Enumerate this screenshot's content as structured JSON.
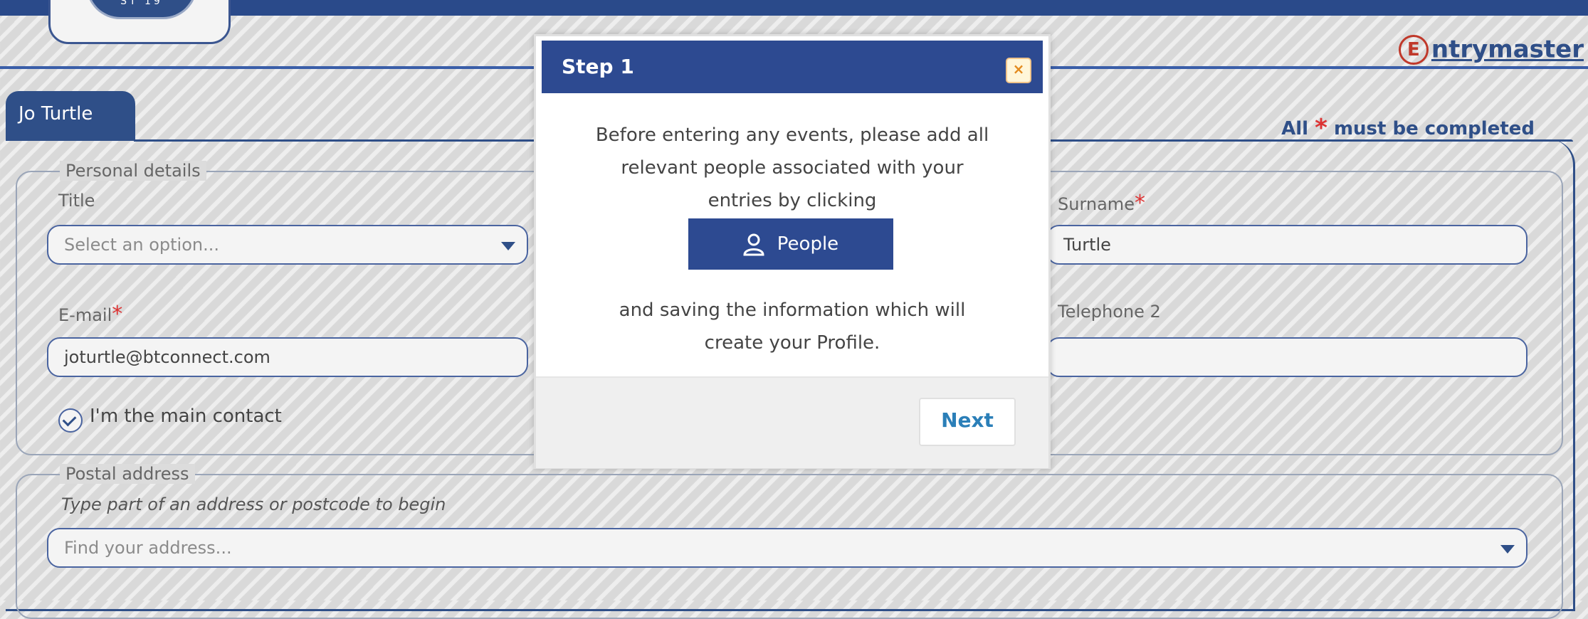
{
  "header": {
    "seal_text": "ST 19",
    "brand_initial": "E",
    "brand_rest": "ntrymaster"
  },
  "tab": {
    "label": "Jo Turtle"
  },
  "required_note": {
    "prefix": "All",
    "star": "*",
    "suffix": "must be completed"
  },
  "personal": {
    "legend": "Personal details",
    "title_label": "Title",
    "title_placeholder": "Select an option...",
    "surname_label": "Surname",
    "surname_star": "*",
    "surname_value": "Turtle",
    "email_label": "E-mail",
    "email_star": "*",
    "email_value": "joturtle@btconnect.com",
    "telephone2_label": "Telephone 2",
    "telephone2_value": "",
    "main_contact_label": "I'm the main contact"
  },
  "postal": {
    "legend": "Postal address",
    "hint": "Type part of an address or postcode to begin",
    "find_placeholder": "Find your address..."
  },
  "modal": {
    "title": "Step 1",
    "close": "×",
    "line1": "Before entering any events, please add all",
    "line2": "relevant people associated with your",
    "line3": "entries by clicking",
    "people_button": "People",
    "line4": "and saving the information which will",
    "line5": "create your Profile.",
    "next_button": "Next"
  },
  "colors": {
    "primary": "#2f4f88",
    "modal_header": "#2d4a91",
    "required_star": "#dd3333",
    "next_text": "#2b7fb8"
  }
}
